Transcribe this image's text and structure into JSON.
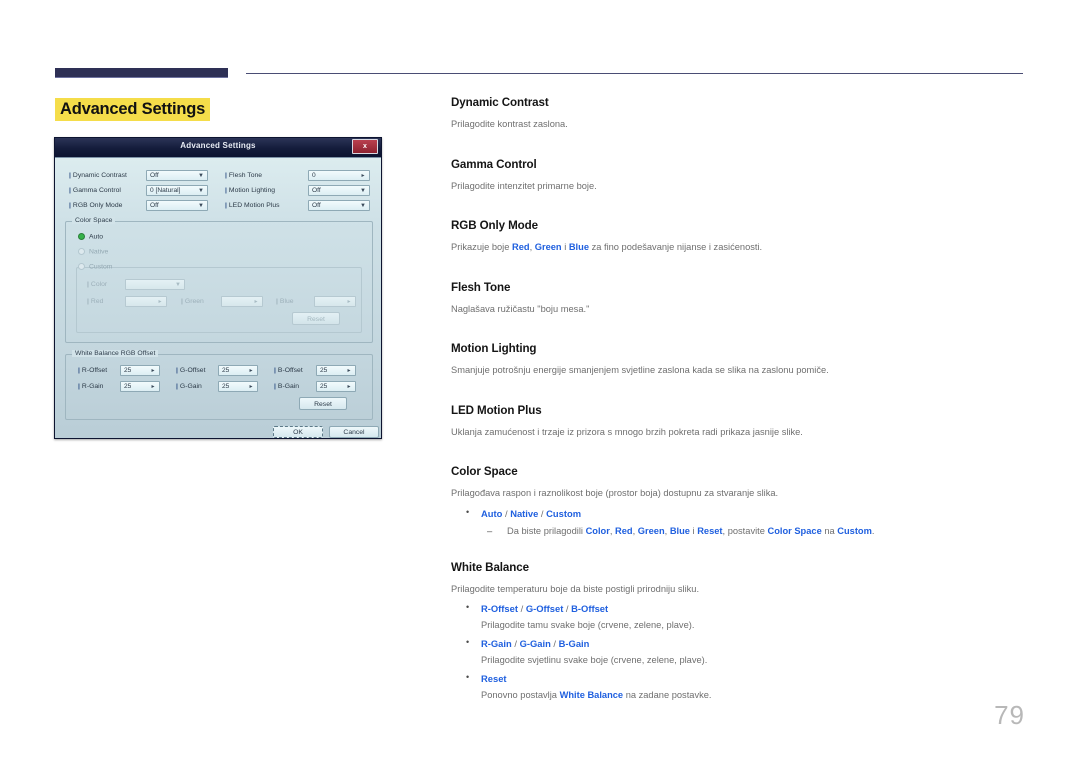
{
  "page": {
    "title": "Advanced Settings",
    "number": "79",
    "accent_highlight": "#f5dd4a",
    "accent_blue": "#2060df",
    "rule_color": "#2e3055"
  },
  "dialog": {
    "titlebar": {
      "title": "Advanced Settings",
      "close_label": "x"
    },
    "fields": [
      {
        "label": "Dynamic Contrast",
        "value": "Off",
        "arrow": "▼"
      },
      {
        "label": "Flesh Tone",
        "value": "0",
        "arrow": "▸"
      },
      {
        "label": "Gamma Control",
        "value": "0 [Natural]",
        "arrow": "▼"
      },
      {
        "label": "Motion Lighting",
        "value": "Off",
        "arrow": "▼"
      },
      {
        "label": "RGB Only Mode",
        "value": "Off",
        "arrow": "▼"
      },
      {
        "label": "LED Motion Plus",
        "value": "Off",
        "arrow": "▼"
      }
    ],
    "color_space": {
      "group_title": "Color Space",
      "radios": [
        {
          "label": "Auto",
          "selected": true
        },
        {
          "label": "Native",
          "selected": false
        },
        {
          "label": "Custom",
          "selected": false
        }
      ],
      "custom_group_title": "Custom",
      "custom_fields": [
        {
          "label": "Color",
          "value": "",
          "arrow": "▼"
        },
        {
          "label": "Red",
          "value": "",
          "arrow": "▸"
        },
        {
          "label": "Green",
          "value": "",
          "arrow": "▸"
        },
        {
          "label": "Blue",
          "value": "",
          "arrow": "▸"
        }
      ],
      "reset_label": "Reset"
    },
    "white_balance": {
      "group_title": "White Balance RGB Offset",
      "fields": [
        {
          "label": "R-Offset",
          "value": "25",
          "arrow": "▸"
        },
        {
          "label": "G-Offset",
          "value": "25",
          "arrow": "▸"
        },
        {
          "label": "B-Offset",
          "value": "25",
          "arrow": "▸"
        },
        {
          "label": "R-Gain",
          "value": "25",
          "arrow": "▸"
        },
        {
          "label": "G-Gain",
          "value": "25",
          "arrow": "▸"
        },
        {
          "label": "B-Gain",
          "value": "25",
          "arrow": "▸"
        }
      ],
      "reset_label": "Reset"
    },
    "ok_label": "OK",
    "cancel_label": "Cancel"
  },
  "sections": {
    "dynamic_contrast": {
      "title": "Dynamic Contrast",
      "desc": "Prilagodite kontrast zaslona."
    },
    "gamma_control": {
      "title": "Gamma Control",
      "desc": "Prilagodite intenzitet primarne boje."
    },
    "rgb_only_mode": {
      "title": "RGB Only Mode",
      "desc_pre": "Prikazuje boje ",
      "red": "Red",
      "comma": ", ",
      "green": "Green",
      "mid": " i ",
      "blue": "Blue",
      "desc_post": " za fino podešavanje nijanse i zasićenosti."
    },
    "flesh_tone": {
      "title": "Flesh Tone",
      "desc": "Naglašava ružičastu \"boju mesa.\""
    },
    "motion_lighting": {
      "title": "Motion Lighting",
      "desc": "Smanjuje potrošnju energije smanjenjem svjetline zaslona kada se slika na zaslonu pomiče."
    },
    "led_motion_plus": {
      "title": "LED Motion Plus",
      "desc": "Uklanja zamućenost i trzaje iz prizora s mnogo brzih pokreta radi prikaza jasnije slike."
    },
    "color_space": {
      "title": "Color Space",
      "desc": "Prilagođava raspon i raznolikost boje (prostor boja) dostupnu za stvaranje slika.",
      "option_auto": "Auto",
      "option_native": "Native",
      "option_custom": "Custom",
      "slash": " / ",
      "sub_pre": "Da biste prilagodili ",
      "sub_color": "Color",
      "sub_c1": ", ",
      "sub_red": "Red",
      "sub_c2": ", ",
      "sub_green": "Green",
      "sub_c3": ", ",
      "sub_blue": "Blue",
      "sub_i": " i ",
      "sub_reset": "Reset",
      "sub_mid": ", postavite ",
      "sub_colorspace": "Color Space",
      "sub_na": " na ",
      "sub_custom": "Custom",
      "sub_end": "."
    },
    "white_balance": {
      "title": "White Balance",
      "desc": "Prilagodite temperaturu boje da biste postigli prirodniju sliku.",
      "offset_r": "R-Offset",
      "offset_g": "G-Offset",
      "offset_b": "B-Offset",
      "offset_desc": "Prilagodite tamu svake boje (crvene, zelene, plave).",
      "gain_r": "R-Gain",
      "gain_g": "G-Gain",
      "gain_b": "B-Gain",
      "gain_desc": "Prilagodite svjetlinu svake boje (crvene, zelene, plave).",
      "reset": "Reset",
      "reset_pre": "Ponovno postavlja ",
      "reset_term": "White Balance",
      "reset_post": " na zadane postavke.",
      "slash": " / "
    }
  }
}
